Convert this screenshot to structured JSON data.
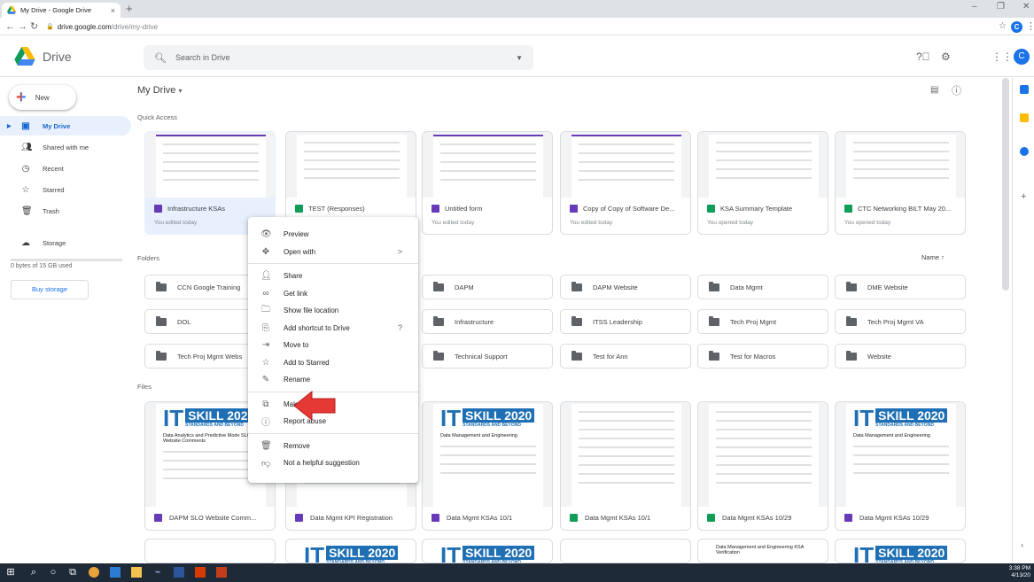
{
  "browser": {
    "tab_title": "My Drive - Google Drive",
    "url_host": "drive.google.com",
    "url_path": "/drive/my-drive",
    "profile_initial": "C"
  },
  "header": {
    "app_name": "Drive",
    "search_placeholder": "Search in Drive",
    "avatar_initial": "C"
  },
  "sidebar": {
    "new_label": "New",
    "items": [
      {
        "label": "My Drive",
        "icon": "my-drive-icon",
        "active": true
      },
      {
        "label": "Shared with me",
        "icon": "people-icon"
      },
      {
        "label": "Recent",
        "icon": "clock-icon"
      },
      {
        "label": "Starred",
        "icon": "star-icon"
      },
      {
        "label": "Trash",
        "icon": "trash-icon"
      }
    ],
    "storage_label": "Storage",
    "storage_used": "0 bytes of 15 GB used",
    "buy_storage": "Buy storage"
  },
  "main": {
    "breadcrumb": "My Drive",
    "quick_access_label": "Quick Access",
    "quick_access": [
      {
        "name": "Infrastructure KSAs",
        "type": "form",
        "sub": "You edited today",
        "thumb_title": "Infrastructure KSAs"
      },
      {
        "name": "TEST (Responses)",
        "type": "sheet",
        "sub": "",
        "thumb_title": ""
      },
      {
        "name": "Untitled form",
        "type": "form",
        "sub": "You edited today",
        "thumb_title": "Test"
      },
      {
        "name": "Copy of Copy of Software De...",
        "type": "form",
        "sub": "You edited today",
        "thumb_title": "Software Development KSAs"
      },
      {
        "name": "KSA Summary Template",
        "type": "sheet",
        "sub": "You opened today",
        "thumb_title": ""
      },
      {
        "name": "CTC Networking BILT May 20...",
        "type": "sheet",
        "sub": "You opened today",
        "thumb_title": ""
      }
    ],
    "folders_label": "Folders",
    "sort_label": "Name",
    "folders": [
      "CCN Google Training",
      "",
      "DAPM",
      "DAPM Website",
      "Data Mgmt",
      "DME Website",
      "DOL",
      "",
      "Infrastructure",
      "ITSS Leadership",
      "Tech Proj Mgmt",
      "Tech Proj Mgmt VA",
      "Tech Proj Mgmt Webs",
      "",
      "Technical Support",
      "Test for Ann",
      "Test for Macros",
      "Website"
    ],
    "files_label": "Files",
    "files": [
      {
        "name": "DAPM SLO Website Comm...",
        "type": "form",
        "itskill": true,
        "ptitle": "Data Analytics and Predictive Mode SLOs Website Comments"
      },
      {
        "name": "Data Mgmt KPI Registration",
        "type": "form",
        "itskill": false,
        "ptitle": ""
      },
      {
        "name": "Data Mgmt KSAs 10/1",
        "type": "form",
        "itskill": true,
        "ptitle": "Data Management and Engineering"
      },
      {
        "name": "Data Mgmt KSAs 10/1",
        "type": "sheet",
        "itskill": false,
        "ptitle": ""
      },
      {
        "name": "Data Mgmt KSAs 10/29",
        "type": "sheet",
        "itskill": false,
        "ptitle": ""
      },
      {
        "name": "Data Mgmt KSAs 10/29",
        "type": "form",
        "itskill": true,
        "ptitle": "Data Management and Engineering"
      }
    ],
    "bottom_row_thumb": "Data Management and Engineering KSA Verification",
    "itskill_logo": {
      "it": "IT",
      "skill": "SKILL 2020",
      "tagline": "STANDARDS AND BEYOND"
    }
  },
  "context_menu": [
    {
      "label": "Preview",
      "icon": "eye-icon"
    },
    {
      "label": "Open with",
      "icon": "open-with-icon",
      "submenu": ">"
    },
    {
      "sep": true
    },
    {
      "label": "Share",
      "icon": "share-icon"
    },
    {
      "label": "Get link",
      "icon": "link-icon"
    },
    {
      "label": "Show file location",
      "icon": "folder-outline-icon"
    },
    {
      "label": "Add shortcut to Drive",
      "icon": "shortcut-icon",
      "help": "?"
    },
    {
      "label": "Move to",
      "icon": "move-to-icon"
    },
    {
      "label": "Add to Starred",
      "icon": "star-icon"
    },
    {
      "label": "Rename",
      "icon": "pencil-icon"
    },
    {
      "sep": true
    },
    {
      "label": "Make a copy",
      "icon": "copy-icon"
    },
    {
      "label": "Report abuse",
      "icon": "report-icon"
    },
    {
      "sep": true
    },
    {
      "label": "Remove",
      "icon": "trash-icon"
    },
    {
      "label": "Not a helpful suggestion",
      "icon": "thumbs-down-icon"
    }
  ],
  "taskbar": {
    "time": "3:38 PM",
    "date": "4/13/20"
  }
}
